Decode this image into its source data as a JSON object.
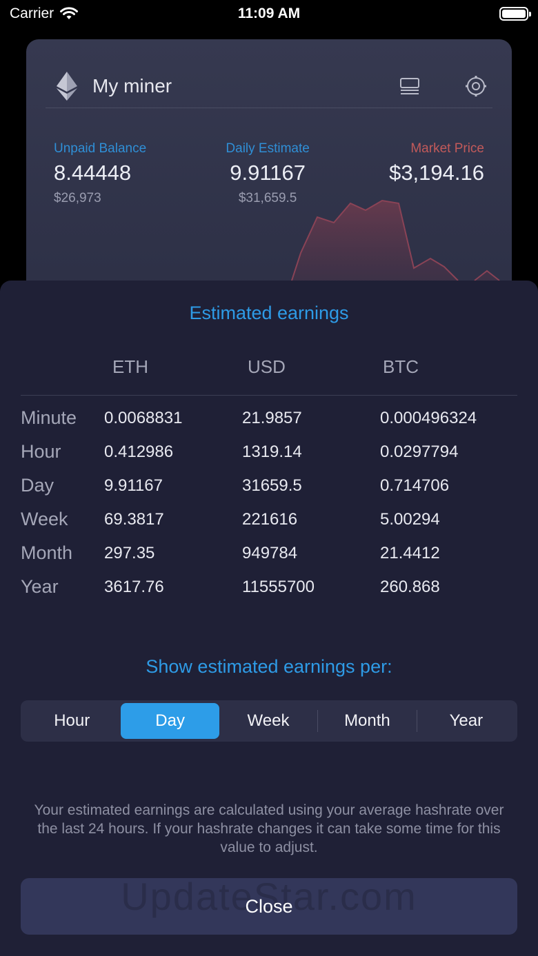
{
  "status_bar": {
    "carrier": "Carrier",
    "time": "11:09 AM"
  },
  "miner": {
    "title": "My miner",
    "unpaid": {
      "label": "Unpaid Balance",
      "value": "8.44448",
      "sub": "$26,973",
      "color": "#2f8fd6"
    },
    "daily": {
      "label": "Daily Estimate",
      "value": "9.91167",
      "sub": "$31,659.5",
      "color": "#2f8fd6"
    },
    "market": {
      "label": "Market Price",
      "value": "$3,194.16",
      "color": "#c25a5a"
    }
  },
  "sheet": {
    "title": "Estimated earnings",
    "columns": [
      "ETH",
      "USD",
      "BTC"
    ],
    "rows": [
      {
        "label": "Minute",
        "eth": "0.0068831",
        "usd": "21.9857",
        "btc": "0.000496324"
      },
      {
        "label": "Hour",
        "eth": "0.412986",
        "usd": "1319.14",
        "btc": "0.0297794"
      },
      {
        "label": "Day",
        "eth": "9.91167",
        "usd": "31659.5",
        "btc": "0.714706"
      },
      {
        "label": "Week",
        "eth": "69.3817",
        "usd": "221616",
        "btc": "5.00294"
      },
      {
        "label": "Month",
        "eth": "297.35",
        "usd": "949784",
        "btc": "21.4412"
      },
      {
        "label": "Year",
        "eth": "3617.76",
        "usd": "11555700",
        "btc": "260.868"
      }
    ],
    "per_title": "Show estimated earnings per:",
    "segments": [
      "Hour",
      "Day",
      "Week",
      "Month",
      "Year"
    ],
    "selected_segment": "Day",
    "footnote": "Your estimated earnings are calculated using your average hashrate over the last 24 hours. If your hashrate changes it can take some time for this value to adjust.",
    "close_label": "Close",
    "watermark": "UpdateStar.com"
  },
  "colors": {
    "accent": "#2d9de8",
    "sheet_bg": "#1f2036"
  }
}
